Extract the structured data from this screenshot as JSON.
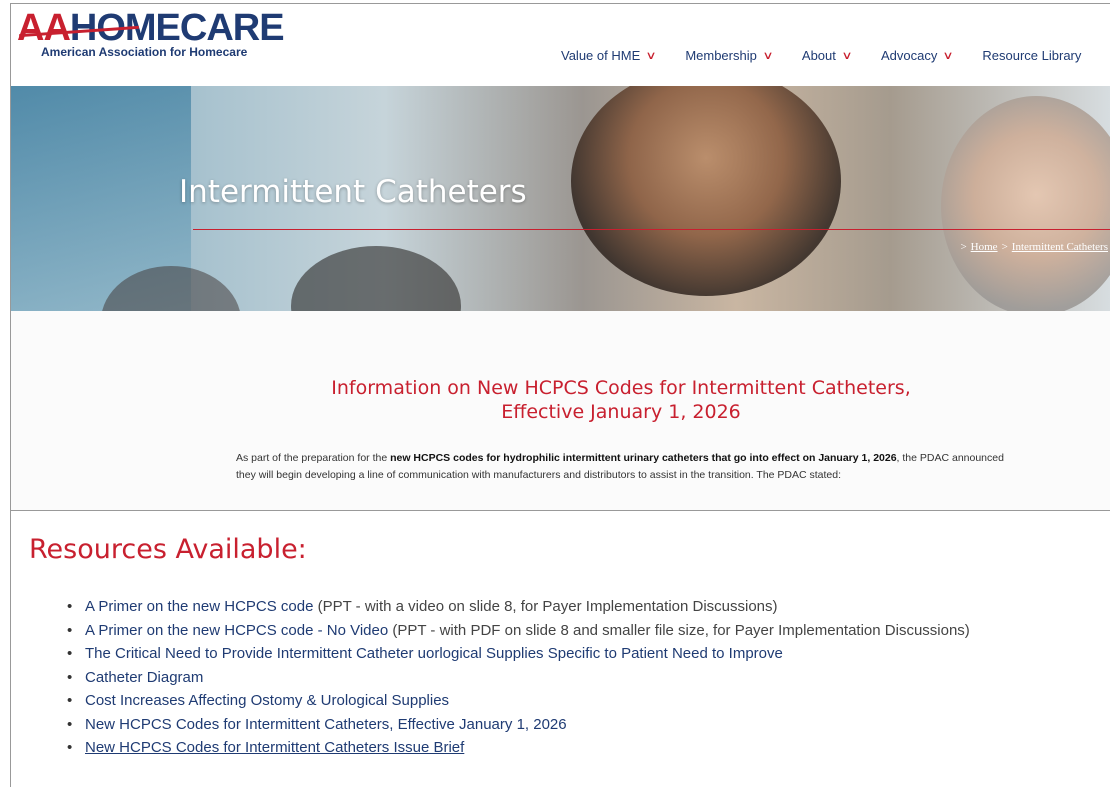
{
  "logo": {
    "text_red": "AA",
    "text_blue": "HOMECARE",
    "subtitle": "American Association for Homecare"
  },
  "nav": {
    "items": [
      {
        "label": "Value of HME",
        "has_dropdown": true
      },
      {
        "label": "Membership",
        "has_dropdown": true
      },
      {
        "label": "About",
        "has_dropdown": true
      },
      {
        "label": "Advocacy",
        "has_dropdown": true
      },
      {
        "label": "Resource Library",
        "has_dropdown": false
      }
    ],
    "chevron": "∨"
  },
  "hero": {
    "title": "Intermittent Catheters",
    "breadcrumb": {
      "separator": ">",
      "home": "Home",
      "current": "Intermittent Catheters"
    }
  },
  "info": {
    "title_line1": "Information on New HCPCS Codes for Intermittent Catheters,",
    "title_line2": "Effective January 1, 2026",
    "paragraph": {
      "p1": "As part of the preparation for the ",
      "b1": "new HCPCS codes for hydrophilic intermittent urinary catheters that ",
      "b2": "go into effect on January 1, 2026",
      "p2": ", the PDAC announced they will begin developing a line of communication with manufacturers and distributors to assist in the transition. The PDAC stated:"
    }
  },
  "resources": {
    "heading": "Resources Available:",
    "items": [
      {
        "link": "A Primer on the new HCPCS code",
        "note": " (PPT - with a video on slide 8, for Payer Implementation Discussions)",
        "underline": false
      },
      {
        "link": "A Primer on the new HCPCS code - No Video",
        "note": " (PPT - with PDF on slide 8 and smaller file size, for Payer Implementation Discussions)",
        "underline": false
      },
      {
        "link": "The Critical Need to Provide Intermittent Catheter uorlogical Supplies Specific to Patient Need to Improve",
        "note": "",
        "underline": false
      },
      {
        "link": "Catheter Diagram",
        "note": "",
        "underline": false
      },
      {
        "link": "Cost Increases Affecting Ostomy & Urological Supplies",
        "note": "",
        "underline": false
      },
      {
        "link": "New HCPCS Codes for Intermittent Catheters, Effective January 1, 2026",
        "note": "",
        "underline": false
      },
      {
        "link": "New HCPCS Codes for Intermittent Catheters Issue Brief",
        "note": "",
        "underline": true
      }
    ]
  },
  "colors": {
    "brand_red": "#c8202f",
    "brand_blue": "#1f3b73"
  }
}
